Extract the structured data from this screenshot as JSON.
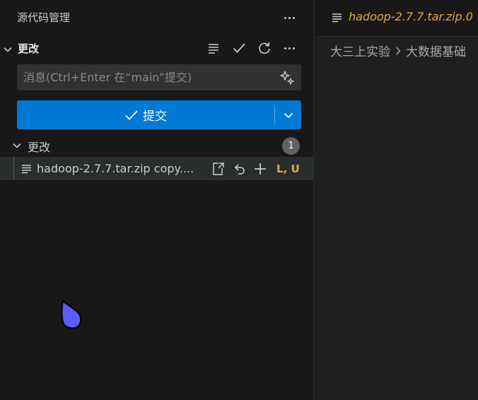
{
  "sidebar": {
    "title": "源代码管理",
    "section_title": "更改",
    "message": {
      "placeholder": "消息(Ctrl+Enter 在“main”提交)",
      "value": ""
    },
    "commit_label": "提交",
    "group": {
      "title": "更改",
      "count": "1"
    },
    "change": {
      "filename": "hadoop-2.7.7.tar.zip copy....",
      "status": "L, U"
    }
  },
  "editor": {
    "tab_name": "hadoop-2.7.7.tar.zip.0",
    "breadcrumb": [
      "大三上实验",
      "大数据基础"
    ]
  },
  "colors": {
    "accent": "#0078d4",
    "modified": "#e2a73d",
    "cursor": "#5b5bff"
  }
}
